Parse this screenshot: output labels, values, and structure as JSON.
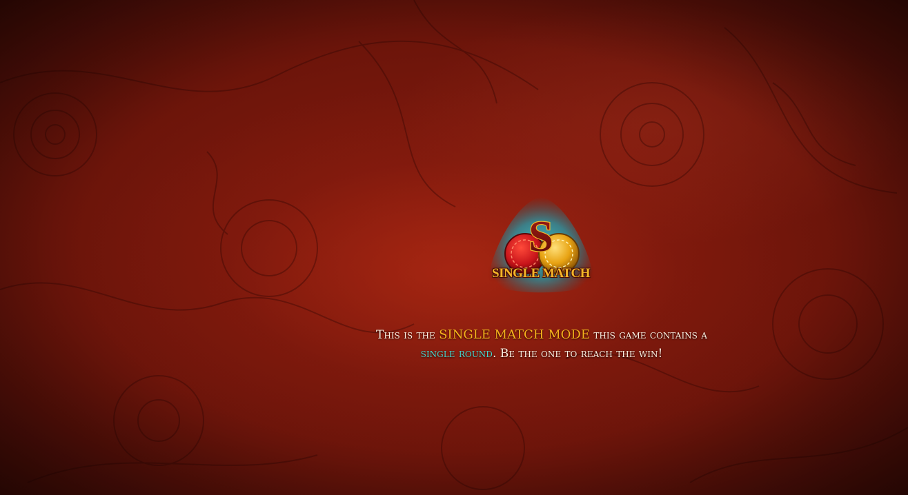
{
  "mode_badge": {
    "letter": "S",
    "label": "SINGLE MATCH",
    "icon": "single-match-chips-icon"
  },
  "description": {
    "part1": "This is the ",
    "highlight1": "SINGLE MATCH MODE",
    "part2": " this game contains a ",
    "highlight2": "single round",
    "part3": ". Be the one to reach the win!"
  },
  "colors": {
    "background": "#7a1a0d",
    "gold": "#f5b21c",
    "cyan": "#48d6cc",
    "badge_glow": "#2fb9c4",
    "chip_red": "#c8141a",
    "chip_gold": "#e8a313",
    "letter": "#7a1410"
  }
}
